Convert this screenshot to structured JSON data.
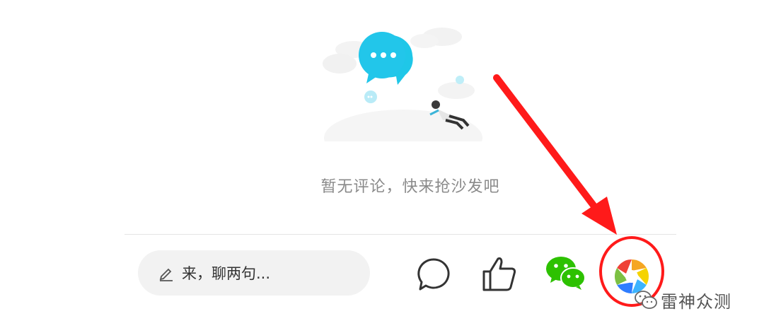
{
  "empty_state": {
    "message": "暂无评论，快来抢沙发吧"
  },
  "comment_bar": {
    "placeholder": "来，聊两句...",
    "icons": {
      "edit": "pencil-icon",
      "comment": "comment-bubble-icon",
      "like": "thumbs-up-icon",
      "wechat": "wechat-icon",
      "moments": "wechat-moments-icon"
    }
  },
  "annotation": {
    "color": "#ff1a1a"
  },
  "watermark": {
    "text": "雷神众测"
  }
}
